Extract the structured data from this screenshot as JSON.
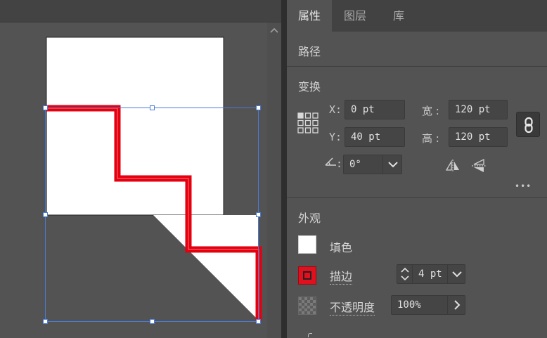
{
  "panel": {
    "tabs": [
      {
        "label": "属性",
        "active": true
      },
      {
        "label": "图层",
        "active": false
      },
      {
        "label": "库",
        "active": false
      }
    ],
    "path_title": "路径",
    "transform": {
      "title": "变换",
      "x_label": "X:",
      "x_value": "0 pt",
      "y_label": "Y:",
      "y_value": "40 pt",
      "width_label": "宽 :",
      "width_value": "120 pt",
      "height_label": "高 :",
      "height_value": "120 pt",
      "angle_label": ":",
      "angle_value": "0°",
      "more": "•••"
    },
    "appearance": {
      "title": "外观",
      "fill_label": "填色",
      "fill_color": "#ffffff",
      "stroke_label": "描边",
      "stroke_color": "#e0101e",
      "stroke_value": "4 pt",
      "opacity_label": "不透明度",
      "opacity_value": "100%"
    }
  },
  "canvas": {
    "stroke_color": "#e3000f",
    "selection_color": "#4a7bd6"
  }
}
